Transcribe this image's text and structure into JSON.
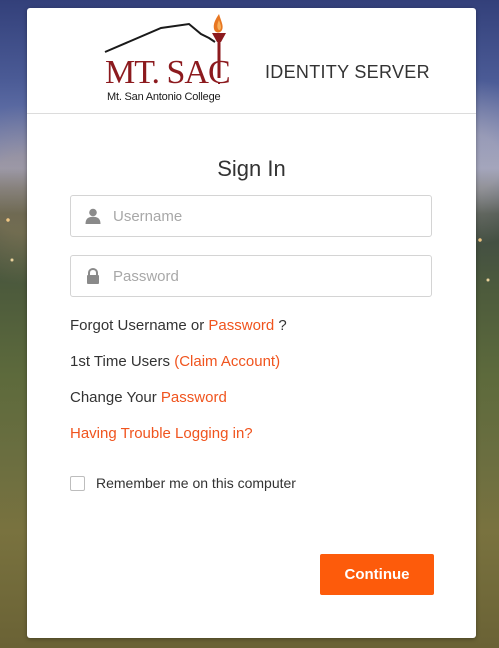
{
  "logo": {
    "main_text": "MT. SAC",
    "sub_text": "Mt. San Antonio College",
    "colors": {
      "maroon": "#8c1a1e",
      "flame": "#e87722"
    }
  },
  "header": {
    "title": "IDENTITY SERVER"
  },
  "signin": {
    "title": "Sign In",
    "username": {
      "placeholder": "Username",
      "value": "",
      "icon": "user-icon"
    },
    "password": {
      "placeholder": "Password",
      "value": "",
      "icon": "lock-icon"
    }
  },
  "links": {
    "forgot": {
      "prefix": "Forgot Username or",
      "link": "Password",
      "suffix": "?"
    },
    "first_time": {
      "prefix": "1st Time Users",
      "link": "(Claim Account)"
    },
    "change": {
      "prefix": "Change Your",
      "link": "Password"
    },
    "trouble": {
      "link": "Having Trouble Logging in?"
    }
  },
  "remember": {
    "label": "Remember me on this computer",
    "checked": false
  },
  "continue_button": {
    "label": "Continue"
  },
  "colors": {
    "accent": "#f0541e",
    "button": "#fd5b0b",
    "text": "#333333"
  }
}
